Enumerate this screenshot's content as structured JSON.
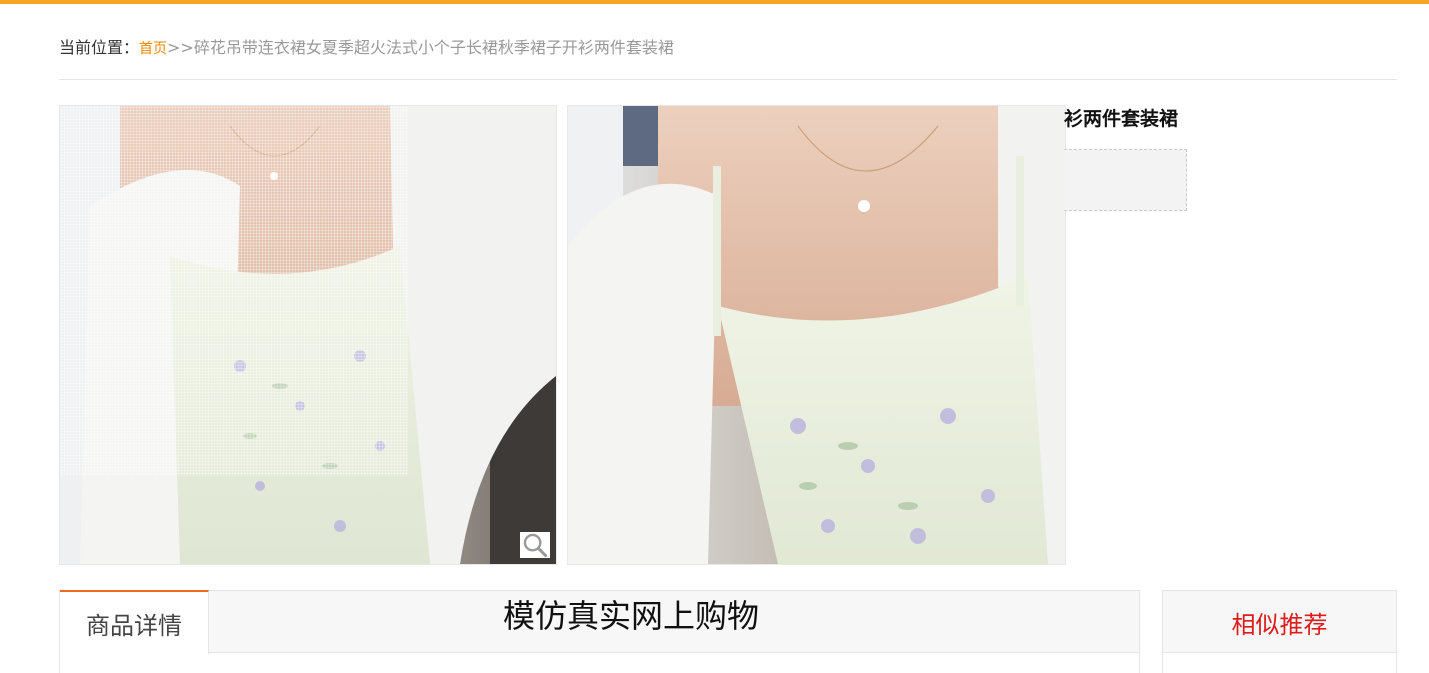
{
  "breadcrumb": {
    "label": "当前位置：",
    "home": "首页",
    "separator": ">>",
    "current": "碎花吊带连衣裙女夏季超火法式小个子长裙秋季裙子开衫两件套装裙"
  },
  "product": {
    "title_visible": "衫两件套装裙",
    "main_image_icon": "dress-photo",
    "zoom_icon": "magnifier-icon"
  },
  "tabs": {
    "active_label": "商品详情"
  },
  "banner": {
    "text": "模仿真实网上购物"
  },
  "side": {
    "title": "相似推荐"
  },
  "colors": {
    "accent": "#f5a623",
    "home_link": "#f08a00",
    "tab_border": "#f06a1f",
    "side_title": "#e01b1b"
  }
}
